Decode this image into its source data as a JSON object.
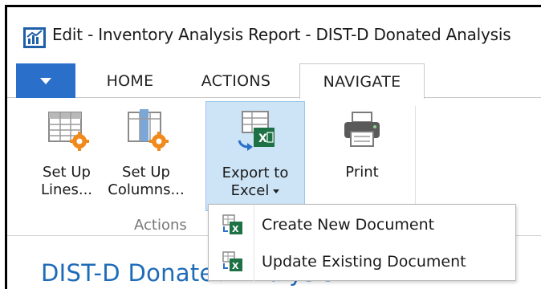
{
  "window": {
    "title": "Edit - Inventory Analysis Report - DIST-D Donated Analysis",
    "app_icon": "chart-icon"
  },
  "ribbon": {
    "tabs": [
      {
        "label": "HOME"
      },
      {
        "label": "ACTIONS"
      },
      {
        "label": "NAVIGATE"
      }
    ],
    "active_tab": "NAVIGATE",
    "buttons": {
      "setup_lines": {
        "line1": "Set Up",
        "line2": "Lines..."
      },
      "setup_columns": {
        "line1": "Set Up",
        "line2": "Columns..."
      },
      "export_excel": {
        "line1": "Export to",
        "line2": "Excel"
      },
      "print": {
        "line1": "Print"
      }
    },
    "group_label": "Actions",
    "accent_color": "#2a6fca"
  },
  "dropdown": {
    "items": [
      {
        "label": "Create New Document",
        "icon": "excel-new-icon"
      },
      {
        "label": "Update Existing Document",
        "icon": "excel-update-icon"
      }
    ]
  },
  "page": {
    "title": "DIST-D Donated Analysis"
  }
}
